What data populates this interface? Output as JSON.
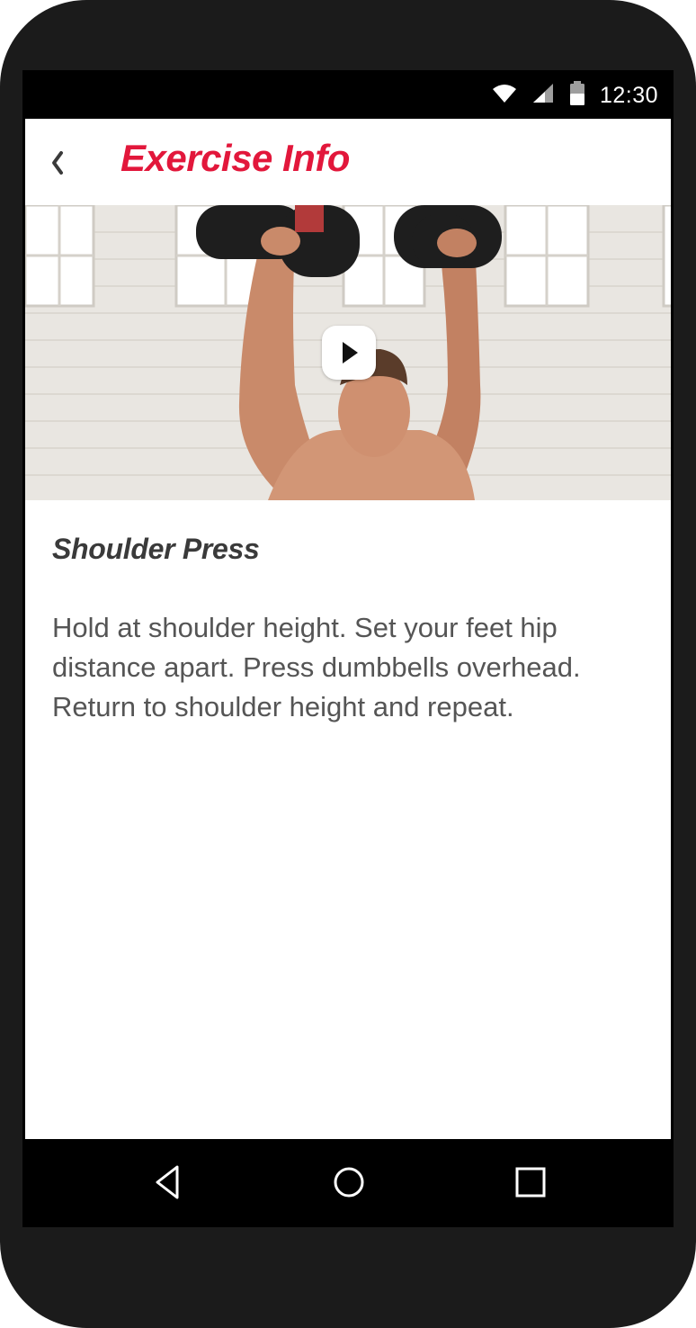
{
  "status_bar": {
    "time": "12:30",
    "icons": [
      "wifi-icon",
      "signal-icon",
      "battery-icon"
    ]
  },
  "app_bar": {
    "title": "Exercise Info",
    "back_icon": "chevron-left-icon"
  },
  "video": {
    "play_icon": "play-icon"
  },
  "exercise": {
    "name": "Shoulder Press",
    "description": "Hold at shoulder height. Set your feet hip distance apart. Press dumbbells overhead. Return to shoulder height and repeat."
  },
  "nav_bar": {
    "icons": [
      "back-triangle-icon",
      "home-circle-icon",
      "recents-square-icon"
    ]
  },
  "colors": {
    "accent": "#e2173b",
    "text_dark": "#3a3a3a",
    "text_body": "#555555"
  }
}
